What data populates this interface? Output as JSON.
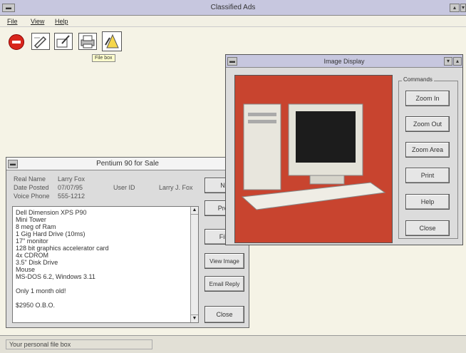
{
  "app": {
    "title": "Classified Ads",
    "menu": [
      {
        "label": "File"
      },
      {
        "label": "View"
      },
      {
        "label": "Help"
      }
    ],
    "toolbar": {
      "tooltip": "File box"
    },
    "status": {
      "text": "Your personal file box"
    }
  },
  "ad_window": {
    "title": "Pentium 90 for Sale",
    "fields": {
      "real_name_label": "Real Name",
      "real_name_value": "Larry Fox",
      "date_posted_label": "Date Posted",
      "date_posted_value": "07/07/95",
      "user_id_label": "User ID",
      "user_id_value": "Larry J. Fox",
      "voice_phone_label": "Voice Phone",
      "voice_phone_value": "555-1212"
    },
    "body_lines": [
      "Dell Dimension XPS P90",
      "Mini Tower",
      "8 meg of Ram",
      "1 Gig Hard Drive (10ms)",
      "17\" monitor",
      "128 bit graphics accelerator card",
      "4x CDROM",
      "3.5\" Disk Drive",
      "Mouse",
      "MS-DOS 6.2, Windows 3.11",
      "",
      "Only 1 month old!",
      "",
      "$2950 O.B.O."
    ],
    "buttons": {
      "next": "Ne",
      "prev": "Prev",
      "file": "File",
      "view_image": "View Image",
      "email_reply": "Email Reply",
      "close": "Close"
    }
  },
  "image_window": {
    "title": "Image Display",
    "commands_label": "Commands",
    "buttons": {
      "zoom_in": "Zoom In",
      "zoom_out": "Zoom Out",
      "zoom_area": "Zoom Area",
      "print": "Print",
      "help": "Help",
      "close": "Close"
    }
  },
  "colors": {
    "desktop": "#f5f3e6",
    "titlebar": "#c7c7df",
    "image_bg": "#c8442f"
  }
}
